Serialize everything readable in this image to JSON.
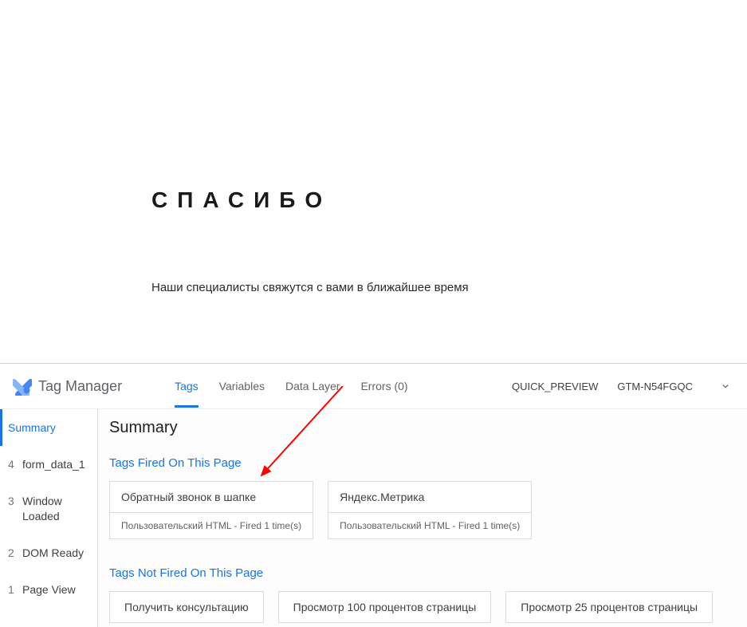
{
  "page": {
    "thanks_title": "СПАСИБО",
    "thanks_subtitle": "Наши специалисты свяжутся с вами в ближайшее время"
  },
  "gtm": {
    "brand": "Tag Manager",
    "tabs": {
      "tags": "Tags",
      "variables": "Variables",
      "data_layer": "Data Layer",
      "errors": "Errors (0)"
    },
    "header_right": {
      "preview": "QUICK_PREVIEW",
      "container_id": "GTM-N54FGQC"
    },
    "sidebar": {
      "summary": "Summary",
      "items": [
        {
          "num": "4",
          "label": "form_data_1"
        },
        {
          "num": "3",
          "label": "Window Loaded"
        },
        {
          "num": "2",
          "label": "DOM Ready"
        },
        {
          "num": "1",
          "label": "Page View"
        }
      ]
    },
    "main": {
      "title": "Summary",
      "fired_title": "Tags Fired On This Page",
      "not_fired_title": "Tags Not Fired On This Page",
      "fired_tags": [
        {
          "name": "Обратный звонок в шапке",
          "meta": "Пользовательский HTML - Fired 1 time(s)"
        },
        {
          "name": "Яндекс.Метрика",
          "meta": "Пользовательский HTML - Fired 1 time(s)"
        }
      ],
      "not_fired_tags": [
        {
          "name": "Получить консультацию"
        },
        {
          "name": "Просмотр 100 процентов страницы"
        },
        {
          "name": "Просмотр 25 процентов страницы"
        }
      ]
    }
  }
}
